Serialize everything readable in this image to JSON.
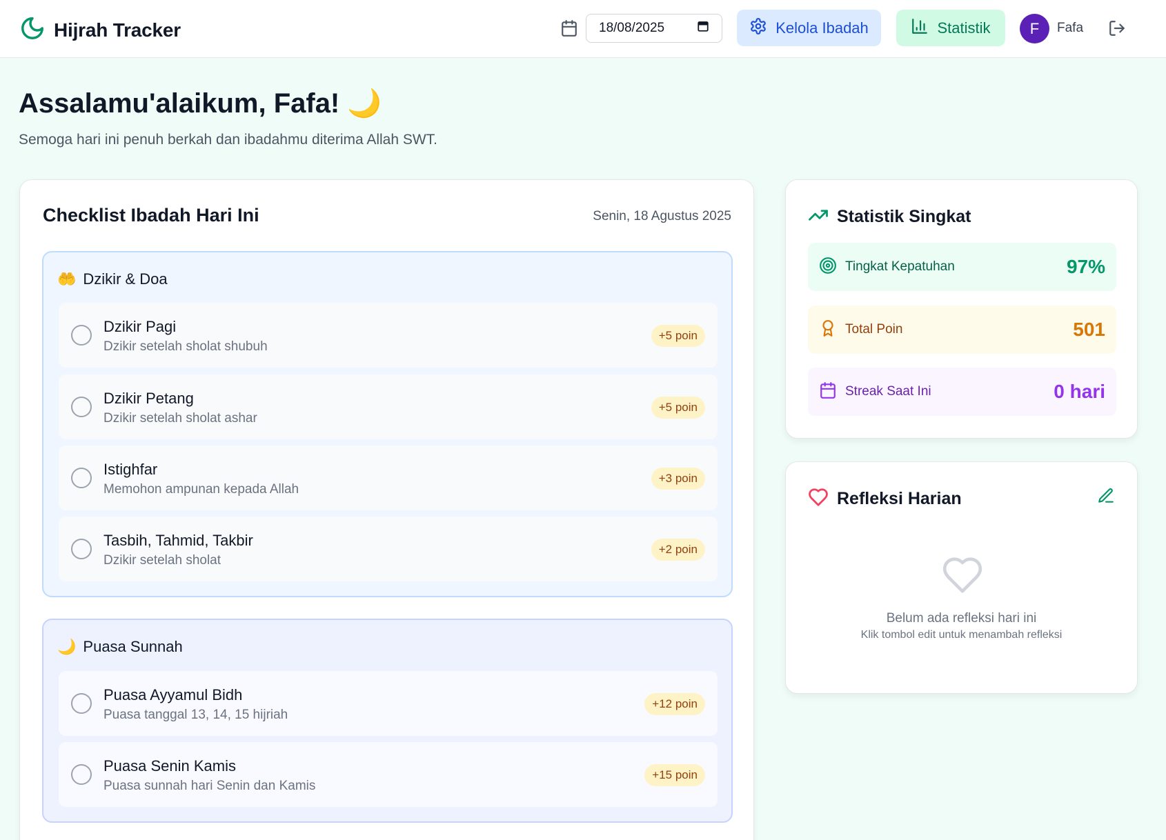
{
  "header": {
    "app_title": "Hijrah Tracker",
    "date_value": "18/08/2025",
    "kelola_label": "Kelola Ibadah",
    "statistik_label": "Statistik",
    "avatar_initial": "F",
    "username": "Fafa"
  },
  "greeting": {
    "title": "Assalamu'alaikum, Fafa! 🌙",
    "subtitle": "Semoga hari ini penuh berkah dan ibadahmu diterima Allah SWT."
  },
  "checklist": {
    "title": "Checklist Ibadah Hari Ini",
    "date": "Senin, 18 Agustus 2025",
    "groups": [
      {
        "emoji": "🤲",
        "title": "Dzikir & Doa",
        "items": [
          {
            "name": "Dzikir Pagi",
            "desc": "Dzikir setelah sholat shubuh",
            "poin": "+5 poin",
            "checked": false
          },
          {
            "name": "Dzikir Petang",
            "desc": "Dzikir setelah sholat ashar",
            "poin": "+5 poin",
            "checked": false
          },
          {
            "name": "Istighfar",
            "desc": "Memohon ampunan kepada Allah",
            "poin": "+3 poin",
            "checked": false
          },
          {
            "name": "Tasbih, Tahmid, Takbir",
            "desc": "Dzikir setelah sholat",
            "poin": "+2 poin",
            "checked": false
          }
        ]
      },
      {
        "emoji": "🌙",
        "title": "Puasa Sunnah",
        "items": [
          {
            "name": "Puasa Ayyamul Bidh",
            "desc": "Puasa tanggal 13, 14, 15 hijriah",
            "poin": "+12 poin",
            "checked": false
          },
          {
            "name": "Puasa Senin Kamis",
            "desc": "Puasa sunnah hari Senin dan Kamis",
            "poin": "+15 poin",
            "checked": false
          }
        ]
      }
    ]
  },
  "stats": {
    "title": "Statistik Singkat",
    "rows": [
      {
        "label": "Tingkat Kepatuhan",
        "value": "97%"
      },
      {
        "label": "Total Poin",
        "value": "501"
      },
      {
        "label": "Streak Saat Ini",
        "value": "0 hari"
      }
    ]
  },
  "reflection": {
    "title": "Refleksi Harian",
    "empty_text": "Belum ada refleksi hari ini",
    "hint_text": "Klik tombol edit untuk menambah refleksi"
  },
  "colors": {
    "brand_green": "#059669",
    "accent_blue": "#1d4ed8",
    "accent_purple": "#9333ea",
    "accent_amber": "#d97706",
    "heart_pink": "#f43f5e"
  }
}
